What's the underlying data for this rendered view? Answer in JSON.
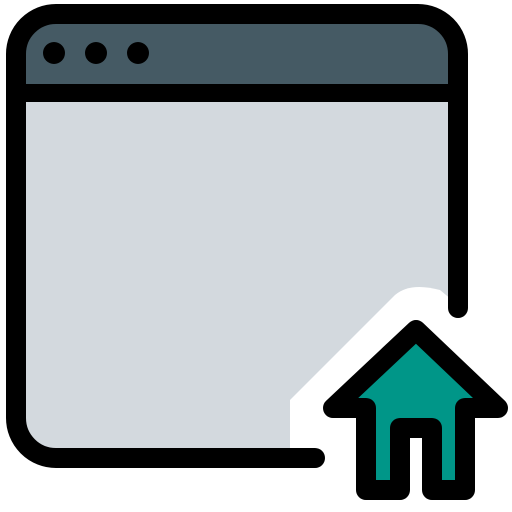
{
  "icon": {
    "name": "browser-home-icon",
    "colors": {
      "outline": "#000000",
      "title_bar": "#455a64",
      "window_body": "#d3d9de",
      "home_fill": "#009688",
      "cutout": "#ffffff",
      "dots": "#000000"
    },
    "window_dots": [
      "window-dot-1",
      "window-dot-2",
      "window-dot-3"
    ]
  }
}
